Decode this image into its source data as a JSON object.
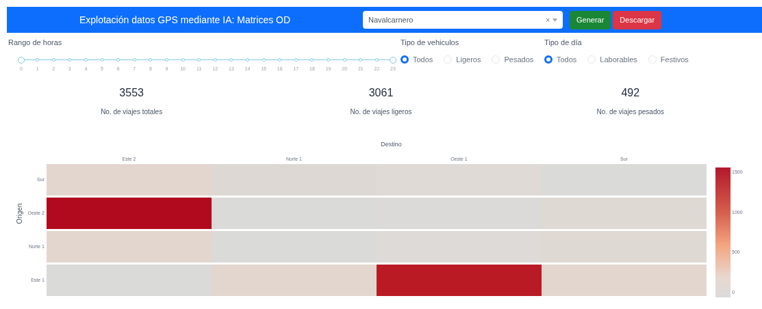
{
  "header": {
    "title": "Explotación datos GPS mediante IA: Matrices OD",
    "dropdown": {
      "value": "Navalcarnero",
      "clear": "×"
    },
    "buttons": [
      {
        "label": "Generar",
        "kind": "success"
      },
      {
        "label": "Descargar",
        "kind": "danger"
      }
    ]
  },
  "hour_range": {
    "label": "Rango de horas",
    "handles": [
      {
        "level": 0
      },
      {
        "level": 1
      }
    ],
    "marks": [
      "0",
      "1",
      "2",
      "3",
      "4",
      "5",
      "6",
      "7",
      "8",
      "9",
      "10",
      "11",
      "12",
      "13",
      "14",
      "15",
      "16",
      "17",
      "18",
      "19",
      "20",
      "21",
      "22",
      "23"
    ]
  },
  "vehicle_type": {
    "label": "Tipo de vehiculos",
    "options": [
      {
        "label": "Todos",
        "selected": true
      },
      {
        "label": "Ligeros",
        "selected": false
      },
      {
        "label": "Pesados",
        "selected": false
      }
    ]
  },
  "day_type": {
    "label": "Tipo de día",
    "options": [
      {
        "label": "Todos",
        "selected": true
      },
      {
        "label": "Laborables",
        "selected": false
      },
      {
        "label": "Festivos",
        "selected": false
      }
    ]
  },
  "stats": [
    {
      "value": "3553",
      "label": "No. de viajes totales"
    },
    {
      "value": "3061",
      "label": "No. de viajes ligeros"
    },
    {
      "value": "492",
      "label": "No. de viajes pesados"
    }
  ],
  "heatmap": {
    "xlabel": "Destino",
    "ylabel": "Origen",
    "columns": [
      "Este 2",
      "Norte 1",
      "Oeste 1",
      "Sur"
    ],
    "rows": [
      {
        "label": "Sur",
        "cells": [
          {
            "color": "#e3d6cf"
          },
          {
            "color": "#ddd8d3"
          },
          {
            "color": "#dfdad5"
          },
          {
            "color": "#dadad9"
          }
        ]
      },
      {
        "label": "Oeste 2",
        "cells": [
          {
            "color": "#b10a1e"
          },
          {
            "color": "#dadad9"
          },
          {
            "color": "#dbdad8"
          },
          {
            "color": "#ded9d3"
          }
        ]
      },
      {
        "label": "Norte 1",
        "cells": [
          {
            "color": "#e3d6cf"
          },
          {
            "color": "#dadad9"
          },
          {
            "color": "#dddad8"
          },
          {
            "color": "#dfd9d4"
          }
        ]
      },
      {
        "label": "Este 1",
        "cells": [
          {
            "color": "#dadad9"
          },
          {
            "color": "#e3d6cf"
          },
          {
            "color": "#b91a24"
          },
          {
            "color": "#e3d6cf"
          }
        ]
      }
    ],
    "colorbar_ticks": [
      "1500",
      "1000",
      "500",
      "0"
    ]
  }
}
